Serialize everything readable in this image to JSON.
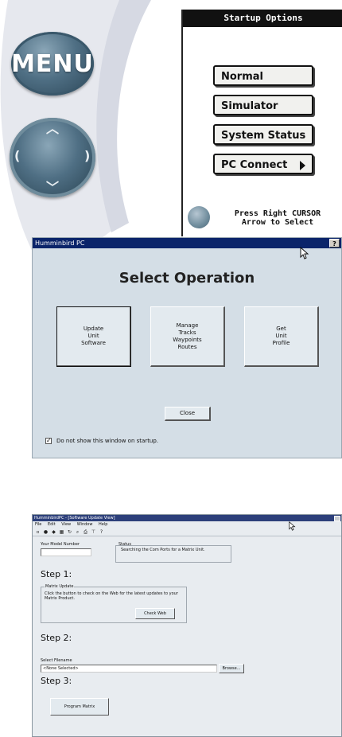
{
  "device": {
    "menu_button_label": "MENU",
    "screen_title": "Startup Options",
    "options": [
      {
        "label": "Normal"
      },
      {
        "label": "Simulator"
      },
      {
        "label": "System Status"
      },
      {
        "label": "PC Connect"
      }
    ],
    "hint_line1": "Press Right CURSOR",
    "hint_line2": "Arrow to Select"
  },
  "dialog": {
    "window_title": "Humminbird PC",
    "help_label": "?",
    "heading": "Select Operation",
    "buttons": [
      {
        "label": "Update\nUnit\nSoftware"
      },
      {
        "label": "Manage\nTracks\nWaypoints\nRoutes"
      },
      {
        "label": "Get\nUnit\nProfile"
      }
    ],
    "close_label": "Close",
    "startup_checkbox_label": "Do not show this window on startup.",
    "startup_checkbox_checked": true
  },
  "update_window": {
    "window_title": "HumminbirdPC - [Software Update View]",
    "menu": [
      "File",
      "Edit",
      "View",
      "Window",
      "Help"
    ],
    "model_number_label": "Your Model Number",
    "model_number_value": "",
    "status_label": "Status",
    "status_text": "Searching the Com Ports for a Matrix Unit.",
    "step1_heading": "Step 1:",
    "step1_group_label": "Matrix Update",
    "step1_text": "Click the button to check on the Web for the latest updates to your Matrix Product.",
    "check_web_label": "Check Web",
    "step2_heading": "Step 2:",
    "select_filename_label": "Select Filename",
    "filename_value": "<None Selected>",
    "browse_label": "Browse...",
    "step3_heading": "Step 3:",
    "program_matrix_label": "Program Matrix"
  },
  "colors": {
    "title_bar": "#0a246a",
    "dialog_bg": "#d4dee6",
    "device_button": "#4f6f84"
  }
}
